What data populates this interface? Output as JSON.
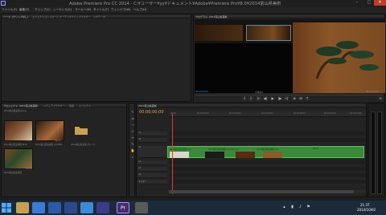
{
  "window": {
    "title": "Adobe Premiere Pro CC 2014 - C:¥ユーザー¥yy¥ドキュメント¥Adobe¥Premiere Pro¥8.0¥2014富山県美術",
    "min": "–",
    "max": "□",
    "close": "✕"
  },
  "menu": [
    "ファイル(F)",
    "編集(E)",
    "クリップ(C)",
    "シーケンス(S)",
    "マーカー(M)",
    "タイトル(T)",
    "ウィンドウ(W)",
    "ヘルプ(H)"
  ],
  "source": {
    "tabs": [
      "ソース: (クリップなし)",
      "エフェクトコントロール",
      "オーディオクリップミキサー",
      "メタデータ"
    ]
  },
  "program": {
    "tab": "プログラム: 2014富山県美術",
    "timecode_left": "00;00;00;00",
    "fit": "全体表示",
    "timecode_right": "00;03;09;15",
    "controls": [
      "{",
      "}",
      "|←",
      "◀|",
      "▶",
      "|▶",
      "→|",
      "⊕",
      "⊞",
      "⤒",
      "+"
    ]
  },
  "project": {
    "tabs": [
      "プロジェクト: 2014富山県美術",
      "メディアブラウザー",
      "情報",
      "エフェクト"
    ],
    "path": "2014富山県美術.prproj",
    "items": [
      {
        "label": "2014富山県美術館.MTS",
        "dur": "1;54"
      },
      {
        "label": "2014富山県美術館 (2).MTS",
        "dur": "59;14"
      },
      {
        "label": "2014富山県美術 (ポッド)",
        "dur": ""
      },
      {
        "label": "2014富山県美術館",
        "dur": "03;09"
      }
    ]
  },
  "timeline": {
    "tab": "2014富山県美術",
    "timecode": "00;00;00;00",
    "ticks": [
      "00;00",
      "00;00;32;00",
      "00;01;04;02",
      "00;01;36;02",
      "00;02;08;04",
      "00;02;40;04",
      "00;03;12;06"
    ],
    "tracks": [
      "V3",
      "V2",
      "V1",
      "A1",
      "A2",
      "A3",
      "マスター"
    ],
    "clips": [
      "2014富山県美術館 [V]",
      "2014富山県美術館 (2).MTS [V]",
      "2014富山県美術館 [V]",
      "2014"
    ]
  },
  "taskbar": {
    "apps": [
      "Explorer",
      "Chrome",
      "Mail",
      "Word",
      "IE",
      "Premiere",
      "Media"
    ],
    "time": "21:37",
    "date": "2014/10/02"
  },
  "colors": {
    "accent": "#3f9fff",
    "timecode": "#e6a53a",
    "clip": "#3a8a3a",
    "close": "#c23b2a"
  }
}
